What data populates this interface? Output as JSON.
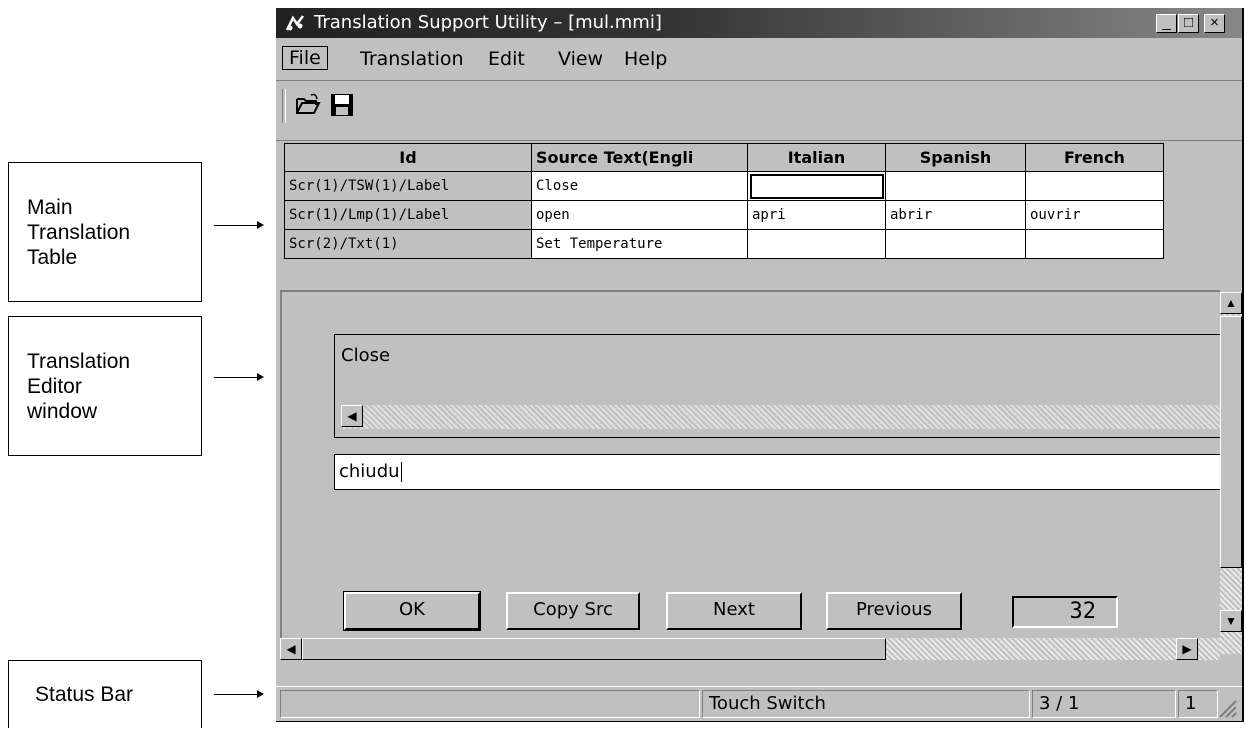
{
  "callouts": {
    "main_table": "Main\nTranslation\nTable",
    "editor": "Translation\nEditor\nwindow",
    "status": "Status Bar"
  },
  "window": {
    "title": "Translation Support Utility – [mul.mmi]",
    "minimize": "_",
    "maximize": "□",
    "close": "×"
  },
  "menu": [
    "File",
    "Translation",
    "Edit",
    "View",
    "Help"
  ],
  "toolbar": {
    "open_icon": "folder-open-icon",
    "save_icon": "floppy-save-icon"
  },
  "table": {
    "headers": [
      "Id",
      "Source Text(Engli",
      "Italian",
      "Spanish",
      "French"
    ],
    "rows": [
      [
        "Scr(1)/TSW(1)/Label",
        "Close",
        "",
        "",
        ""
      ],
      [
        "Scr(1)/Lmp(1)/Label",
        "open",
        "apri",
        "abrir",
        "ouvrir"
      ],
      [
        "Scr(2)/Txt(1)",
        "Set Temperature",
        "",
        "",
        ""
      ]
    ]
  },
  "editor": {
    "source_text": "Close",
    "translation_value": "chiudu",
    "buttons": {
      "ok": "OK",
      "copy_src": "Copy Src",
      "next": "Next",
      "previous": "Previous"
    },
    "counter": "32"
  },
  "status": {
    "type": "Touch Switch",
    "position": "3 / 1",
    "extra": "1"
  }
}
